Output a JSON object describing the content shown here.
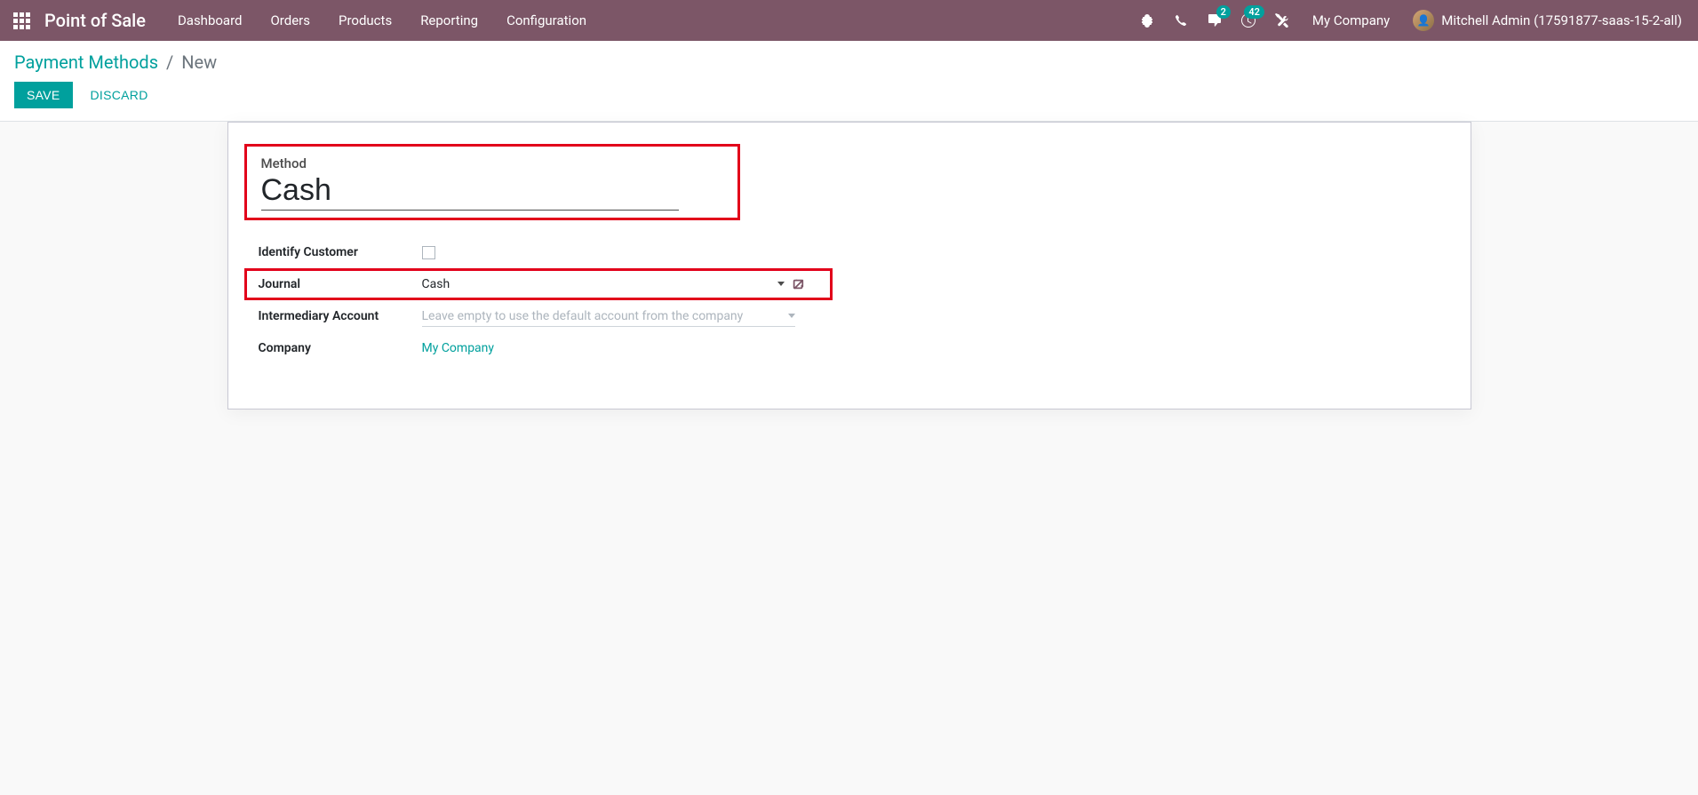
{
  "navbar": {
    "brand": "Point of Sale",
    "menu": [
      "Dashboard",
      "Orders",
      "Products",
      "Reporting",
      "Configuration"
    ],
    "messages_badge": "2",
    "activities_badge": "42",
    "company": "My Company",
    "user": "Mitchell Admin (17591877-saas-15-2-all)"
  },
  "breadcrumb": {
    "parent": "Payment Methods",
    "current": "New"
  },
  "buttons": {
    "save": "Save",
    "discard": "Discard"
  },
  "form": {
    "method_label": "Method",
    "method_value": "Cash",
    "identify_customer_label": "Identify Customer",
    "journal_label": "Journal",
    "journal_value": "Cash",
    "intermediary_label": "Intermediary Account",
    "intermediary_placeholder": "Leave empty to use the default account from the company",
    "company_label": "Company",
    "company_value": "My Company"
  }
}
